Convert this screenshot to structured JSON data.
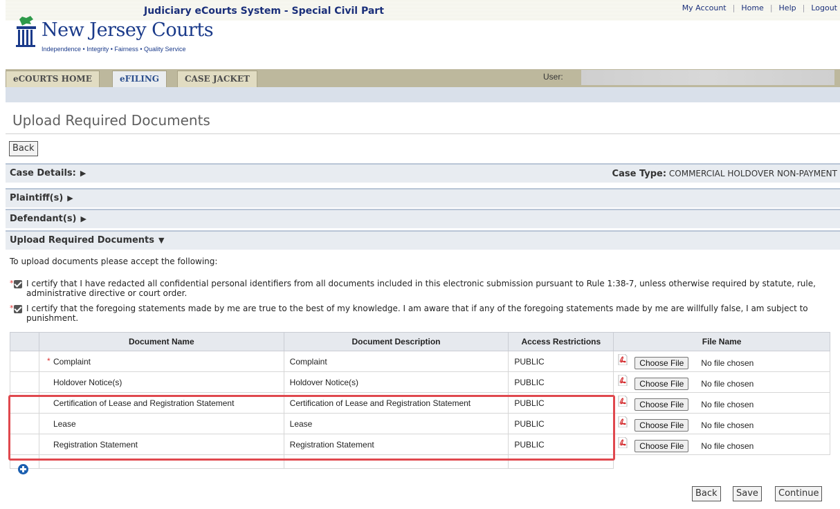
{
  "header": {
    "system_title": "Judiciary eCourts System - Special Civil Part",
    "top_links": [
      "My Account",
      "Home",
      "Help",
      "Logout"
    ],
    "logo_text": "New Jersey Courts",
    "logo_tagline": "Independence • Integrity • Fairness • Quality Service",
    "tabs": [
      "eCOURTS HOME",
      "eFILING",
      "CASE JACKET"
    ],
    "active_tab": "eFILING",
    "user_label": "User:"
  },
  "page": {
    "title": "Upload Required Documents",
    "back_label": "Back"
  },
  "sections": {
    "case_details": "Case Details:",
    "case_type_label": "Case Type:",
    "case_type_value": "COMMERCIAL HOLDOVER NON-PAYMENT",
    "plaintiffs": "Plaintiff(s)",
    "defendants": "Defendant(s)",
    "upload": "Upload Required Documents"
  },
  "intro": "To upload documents please accept the following:",
  "certifications": [
    {
      "required_marker": "*",
      "text": "I certify that I have redacted all confidential personal identifiers from all documents included in this electronic submission pursuant to Rule 1:38-7, unless otherwise required by statute, rule, administrative directive or court order."
    },
    {
      "required_marker": "*",
      "text": "I certify that the foregoing statements made by me are true to the best of my knowledge. I am aware that if any of the foregoing statements made by me are willfully false, I am subject to punishment."
    }
  ],
  "table": {
    "headers": [
      "Document Name",
      "Document Description",
      "Access Restrictions",
      "File Name"
    ],
    "choose_file_label": "Choose File",
    "no_file_label": "No file chosen",
    "rows": [
      {
        "required": "*",
        "name": "Complaint",
        "description": "Complaint",
        "access": "PUBLIC"
      },
      {
        "required": "",
        "name": "Holdover Notice(s)",
        "description": "Holdover Notice(s)",
        "access": "PUBLIC"
      },
      {
        "required": "",
        "name": "Certification of Lease and Registration Statement",
        "description": "Certification of Lease and Registration Statement",
        "access": "PUBLIC"
      },
      {
        "required": "",
        "name": "Lease",
        "description": "Lease",
        "access": "PUBLIC"
      },
      {
        "required": "",
        "name": "Registration Statement",
        "description": "Registration Statement",
        "access": "PUBLIC"
      }
    ]
  },
  "footer_buttons": {
    "back": "Back",
    "save": "Save",
    "continue": "Continue"
  },
  "colors": {
    "accent": "#1a2f7a",
    "highlight_border": "#e0484e",
    "section_bg": "#e8ecf1"
  }
}
